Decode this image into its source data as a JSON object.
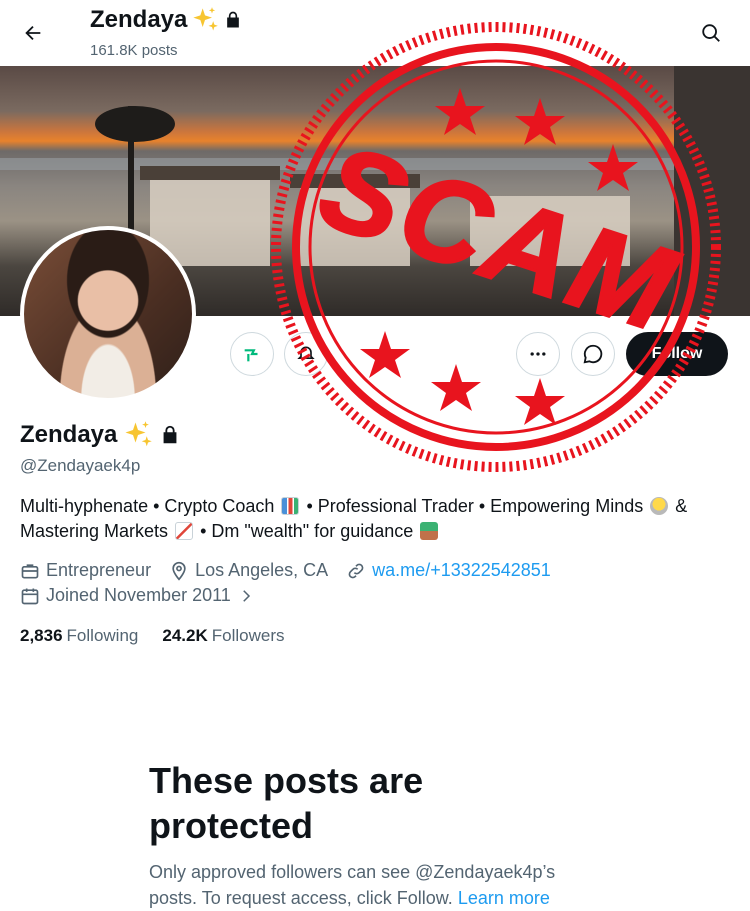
{
  "header": {
    "title": "Zendaya",
    "posts_count": "161.8K posts",
    "back_icon": "arrow-left-icon",
    "search_icon": "search-icon"
  },
  "profile": {
    "display_name": "Zendaya",
    "handle": "@Zendayaek4p",
    "bio_parts": [
      "Multi-hyphenate • Crypto Coach",
      "• Professional Trader • Empowering Minds",
      "&",
      "Mastering Markets",
      "• Dm \"wealth\" for guidance"
    ],
    "profession": "Entrepreneur",
    "location": "Los Angeles, CA",
    "website": "wa.me/+13322542851",
    "joined": "Joined November 2011",
    "following_count": "2,836",
    "following_label": "Following",
    "followers_count": "24.2K",
    "followers_label": "Followers"
  },
  "actions": {
    "follow_label": "Follow"
  },
  "protected": {
    "title": "These posts are protected",
    "body": "Only approved followers can see @Zendayaek4p’s posts. To request access, click Follow.",
    "learn_more": "Learn more"
  },
  "stamp": {
    "text": "SCAM",
    "color": "#e8141e"
  },
  "colors": {
    "text": "#0f1419",
    "muted": "#536471",
    "link": "#1d9bf0",
    "follow_bg": "#0f1419"
  }
}
